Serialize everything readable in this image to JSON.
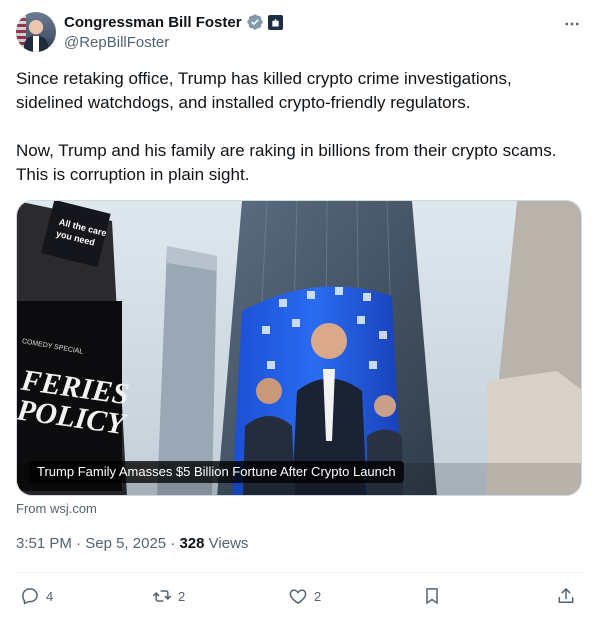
{
  "author": {
    "display_name": "Congressman Bill Foster",
    "handle": "@RepBillFoster",
    "verified_icon": "verified-badge-icon",
    "affiliation_icon": "government-badge-icon"
  },
  "tweet": {
    "paragraphs": [
      "Since retaking office, Trump has killed crypto crime investigations, sidelined watchdogs, and installed crypto-friendly regulators.",
      "Now, Trump and his family are raking in billions from their crypto scams. This is corruption in plain sight."
    ]
  },
  "card": {
    "title": "Trump Family Amasses $5 Billion Fortune After Crypto Launch",
    "source": "From wsj.com",
    "image_signs": [
      "All the care you need",
      "FERIES POLICY",
      "COMEDY SPECIAL"
    ]
  },
  "meta": {
    "time": "3:51 PM",
    "separator": "·",
    "date": "Sep 5, 2025",
    "views_count": "328",
    "views_label": "Views"
  },
  "actions": {
    "replies": "4",
    "reposts": "2",
    "likes": "2"
  },
  "colors": {
    "text": "#0f1419",
    "secondary": "#536471",
    "verified": "#829aab",
    "divider": "#eff3f4"
  }
}
